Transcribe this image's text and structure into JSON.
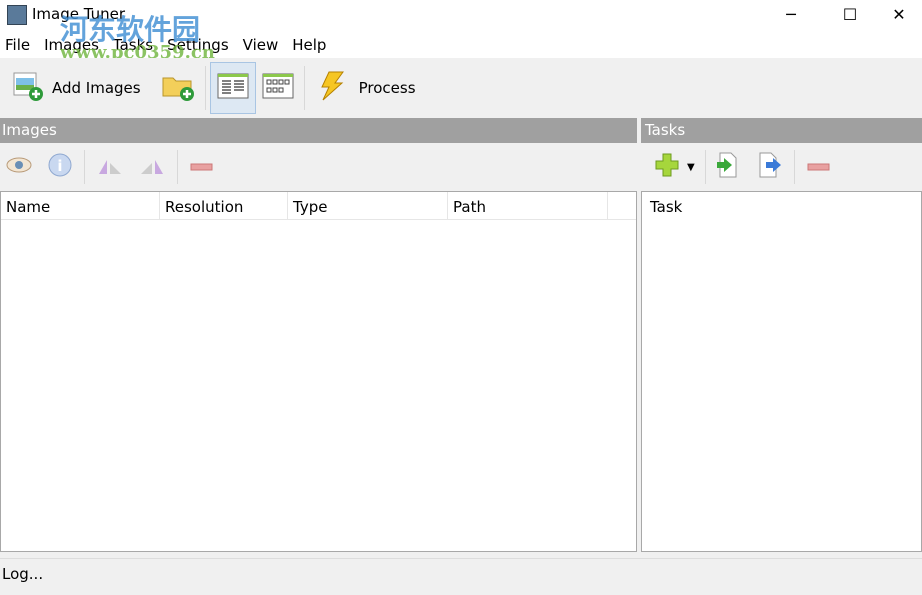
{
  "window": {
    "title": "Image Tuner",
    "minimize": "─",
    "maximize": "☐",
    "close": "✕"
  },
  "menu": [
    "File",
    "Images",
    "Tasks",
    "Settings",
    "View",
    "Help"
  ],
  "toolbar": {
    "add_images": "Add Images",
    "process": "Process"
  },
  "images_panel": {
    "title": "Images",
    "columns": [
      "Name",
      "Resolution",
      "Type",
      "Path"
    ]
  },
  "tasks_panel": {
    "title": "Tasks",
    "columns": [
      "Task"
    ]
  },
  "status": {
    "log": "Log..."
  },
  "watermark": {
    "line1": "河东软件园",
    "line2": "www.pc0359.cn"
  }
}
